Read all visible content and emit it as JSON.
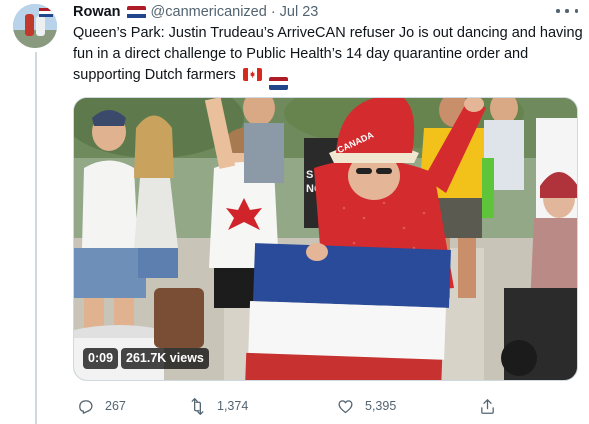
{
  "tweet": {
    "author_name": "Rowan",
    "author_handle": "@canmericanized",
    "separator": "·",
    "date": "Jul 23",
    "text": "Queen’s Park: Justin Trudeau’s ArriveCAN refuser Jo is out dancing and having fun in a direct challenge to Public Health’s 14 day quarantine order and supporting Dutch farmers",
    "name_flag": "netherlands-flag-icon",
    "text_flags": [
      "canada-flag-icon",
      "netherlands-flag-icon"
    ]
  },
  "media": {
    "duration": "0:09",
    "views": "261.7K views",
    "shirt_text": "CANADA"
  },
  "actions": {
    "replies": "267",
    "retweets": "1,374",
    "likes": "5,395"
  },
  "colors": {
    "nl_red": "#ae1c28",
    "nl_white": "#ffffff",
    "nl_blue": "#21468b",
    "text_primary": "#0f1419",
    "text_secondary": "#536471"
  }
}
